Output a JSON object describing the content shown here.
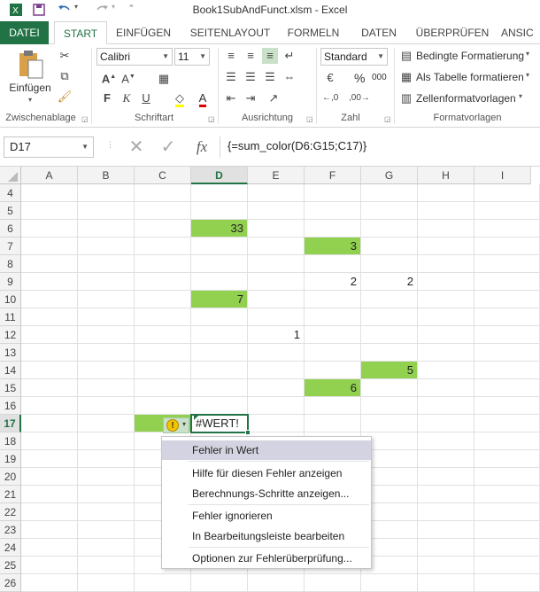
{
  "window": {
    "title": "Book1SubAndFunct.xlsm - Excel"
  },
  "quick_access": {
    "save_icon": "save-icon",
    "undo_icon": "undo-icon",
    "redo_icon": "redo-icon"
  },
  "tabs": [
    {
      "label": "DATEI"
    },
    {
      "label": "START"
    },
    {
      "label": "EINFÜGEN"
    },
    {
      "label": "SEITENLAYOUT"
    },
    {
      "label": "FORMELN"
    },
    {
      "label": "DATEN"
    },
    {
      "label": "ÜBERPRÜFEN"
    },
    {
      "label": "ANSIC"
    }
  ],
  "ribbon": {
    "clipboard": {
      "paste_label": "Einfügen",
      "group_label": "Zwischenablage"
    },
    "font": {
      "name": "Calibri",
      "size": "11",
      "bold": "F",
      "italic": "K",
      "underline": "U",
      "group_label": "Schriftart"
    },
    "alignment": {
      "group_label": "Ausrichtung"
    },
    "number": {
      "format": "Standard",
      "percent": "%",
      "thousands": "000",
      "group_label": "Zahl"
    },
    "styles": {
      "conditional": "Bedingte Formatierung",
      "as_table": "Als Tabelle formatieren",
      "cell_styles": "Zellenformatvorlagen",
      "group_label": "Formatvorlagen"
    }
  },
  "formula_bar": {
    "name_box": "D17",
    "fx": "fx",
    "formula": "{=sum_color(D6:G15;C17)}"
  },
  "sheet": {
    "columns": [
      "A",
      "B",
      "C",
      "D",
      "E",
      "F",
      "G",
      "H",
      "I"
    ],
    "rows": [
      "4",
      "5",
      "6",
      "7",
      "8",
      "9",
      "10",
      "11",
      "12",
      "13",
      "14",
      "15",
      "16",
      "17",
      "18",
      "19",
      "20",
      "21",
      "22",
      "23",
      "24",
      "25",
      "26"
    ],
    "selected_column": "D",
    "selected_row": "17",
    "fill_color": "#92d050",
    "cells": {
      "D6": "33",
      "F7": "3",
      "F9": "2",
      "G9": "2",
      "D10": "7",
      "E12": "1",
      "G14": "5",
      "F15": "6",
      "D17": "#WERT!"
    }
  },
  "error_menu": {
    "items": [
      {
        "label": "Fehler in Wert"
      },
      {
        "label": "Hilfe für diesen Fehler anzeigen"
      },
      {
        "label": "Berechnungs-Schritte anzeigen..."
      },
      {
        "label": "Fehler ignorieren"
      },
      {
        "label": "In Bearbeitungsleiste bearbeiten"
      },
      {
        "label": "Optionen zur Fehlerüberprüfung..."
      }
    ]
  }
}
